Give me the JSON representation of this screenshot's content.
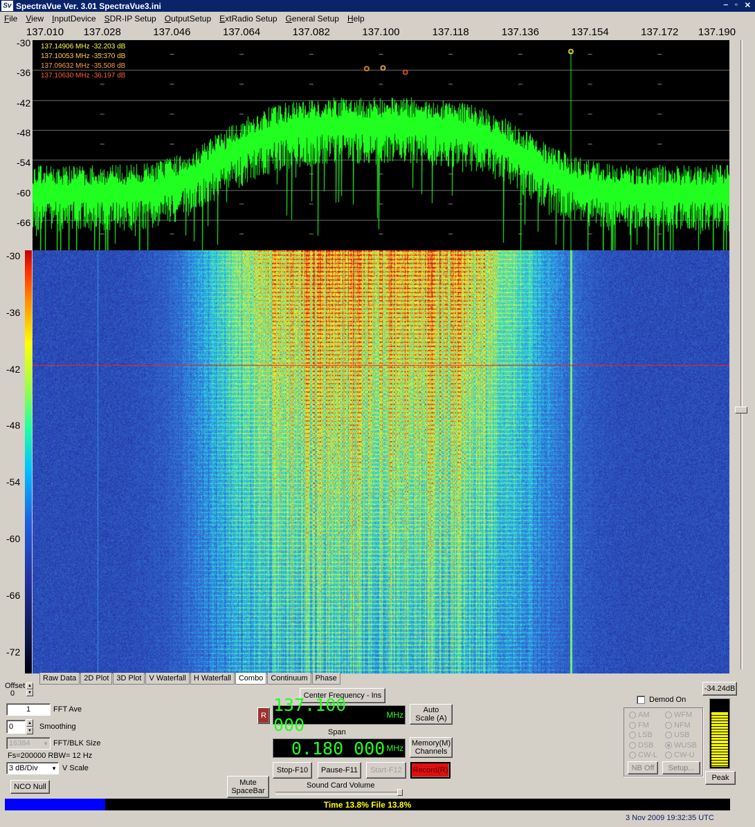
{
  "window": {
    "title": "SpectraVue Ver. 3.01 SpectraVue3.ini",
    "logo": "Sv"
  },
  "menu": [
    "File",
    "View",
    "InputDevice",
    "SDR-IP Setup",
    "OutputSetup",
    "ExtRadio Setup",
    "General Setup",
    "Help"
  ],
  "freq_axis": [
    "137.010",
    "137.028",
    "137.046",
    "137.064",
    "137.082",
    "137.100",
    "137.118",
    "137.136",
    "137.154",
    "137.172",
    "137.190"
  ],
  "spectrum": {
    "y_labels": [
      "-30",
      "-36",
      "-42",
      "-48",
      "-54",
      "-60",
      "-66"
    ],
    "markers": [
      {
        "text": "137.14906 MHz  -32.203 dB",
        "color": "#ffff40",
        "freq": 137.14906,
        "db": -32.203
      },
      {
        "text": "137.10053 MHz  -35.370 dB",
        "color": "#ffd040",
        "freq": 137.10053,
        "db": -35.37
      },
      {
        "text": "137.09632 MHz  -35.508 dB",
        "color": "#ffa040",
        "freq": 137.09632,
        "db": -35.508
      },
      {
        "text": "137.10630 MHz  -36.197 dB",
        "color": "#ff6030",
        "freq": 137.1063,
        "db": -36.197
      }
    ]
  },
  "waterfall": {
    "y_labels": [
      "-30",
      "-36",
      "-42",
      "-48",
      "-54",
      "-60",
      "-66",
      "-72"
    ]
  },
  "tabs": [
    {
      "label": "Raw Data",
      "active": false
    },
    {
      "label": "2D Plot",
      "active": false
    },
    {
      "label": "3D Plot",
      "active": false
    },
    {
      "label": "V Waterfall",
      "active": false
    },
    {
      "label": "H Waterfall",
      "active": false
    },
    {
      "label": "Combo",
      "active": true
    },
    {
      "label": "Continuum",
      "active": false
    },
    {
      "label": "Phase",
      "active": false
    }
  ],
  "controls": {
    "offset_label": "Offset",
    "offset_value": "0",
    "fft_ave_value": "1",
    "fft_ave_label": "FFT Ave",
    "smoothing_value": "0",
    "smoothing_label": "Smoothing",
    "fft_size_value": "16384",
    "fft_size_label": "FFT/BLK Size",
    "fs_text": "Fs=200000 RBW=  12 Hz",
    "vscale_value": "3 dB/Div",
    "vscale_label": "V Scale",
    "nco_null": "NCO Null",
    "mute": "Mute SpaceBar",
    "center_freq_btn": "Center Frequency - Ins",
    "r_btn": "R",
    "center_freq": "137.100 000",
    "freq_unit": "MHz",
    "span_label": "Span",
    "span_value": "0.180 000",
    "span_unit": "MHz",
    "auto_scale": "Auto Scale (A)",
    "memory": "Memory(M) Channels",
    "stop": "Stop-F10",
    "pause": "Pause-F11",
    "start": "Start-F12",
    "record": "Record(R)",
    "sound_vol_label": "Sound Card Volume",
    "demod_on": "Demod On",
    "nb_off": "NB Off",
    "setup": "Setup...",
    "level_readout": "-34.24dB",
    "peak": "Peak",
    "meter_fraction": 0.82
  },
  "modes": [
    {
      "label": "AM",
      "on": false
    },
    {
      "label": "WFM",
      "on": false
    },
    {
      "label": "FM",
      "on": false
    },
    {
      "label": "NFM",
      "on": false
    },
    {
      "label": "LSB",
      "on": false
    },
    {
      "label": "USB",
      "on": false
    },
    {
      "label": "DSB",
      "on": false
    },
    {
      "label": "WUSB",
      "on": true
    },
    {
      "label": "CW-L",
      "on": false
    },
    {
      "label": "CW-U",
      "on": false
    }
  ],
  "status": {
    "time_pct": 13.8,
    "text": "Time 13.8%   File 13.8%",
    "datetime": "3 Nov 2009  19:32:35 UTC"
  },
  "colors": {
    "trace": "#20ff20",
    "record": "#e01010",
    "title_bar": "#0a246a"
  }
}
